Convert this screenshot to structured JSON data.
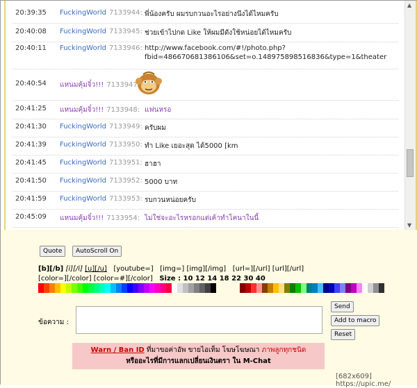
{
  "chat": {
    "rows": [
      {
        "time": "20:39:35",
        "user": "FuckingWorld",
        "msg_id": "7133944:",
        "message": "พี่น้องครับ ผมรบกวนอะไรอย่างนึงได้ไหมครับ",
        "user_color": "blue"
      },
      {
        "time": "20:40:08",
        "user": "FuckingWorld",
        "msg_id": "7133945:",
        "message": "ช่วยเข้าไปกด Like ให้ผมมีดังใช้หน่อยได้ไหมครับ",
        "user_color": "blue"
      },
      {
        "time": "20:40:11",
        "user": "FuckingWorld",
        "msg_id": "7133946:",
        "message": "http://www.facebook.com/#!/photo.php?",
        "message2": "fbid=486670681386106&set=o.148975898516836&type=1&theater",
        "user_color": "blue"
      },
      {
        "time": "20:40:54",
        "user": "แหนมคุ้มจิ๋ว!!!",
        "msg_id": "7133947:",
        "message": "",
        "user_color": "purple",
        "emoticon": "monkey-emoticon"
      },
      {
        "time": "20:41:25",
        "user": "แหนมคุ้มจิ๋ว!!!",
        "msg_id": "7133948:",
        "message": "แฟนหรอ",
        "user_color": "purple"
      },
      {
        "time": "20:41:30",
        "user": "FuckingWorld",
        "msg_id": "7133949:",
        "message": "ครับผม",
        "user_color": "blue"
      },
      {
        "time": "20:41:39",
        "user": "FuckingWorld",
        "msg_id": "7133950:",
        "message": "ทำ Like เยอะสุด ได้5000 [km",
        "user_color": "blue"
      },
      {
        "time": "20:41:45",
        "user": "FuckingWorld",
        "msg_id": "7133951:",
        "message": "ฮาฮา",
        "user_color": "blue"
      },
      {
        "time": "20:41:50",
        "user": "FuckingWorld",
        "msg_id": "7133952:",
        "message": "5000 บาท",
        "user_color": "blue"
      },
      {
        "time": "20:41:59",
        "user": "FuckingWorld",
        "msg_id": "7133953:",
        "message": "รบกวนหน่อยครับ",
        "user_color": "blue"
      },
      {
        "time": "20:45:09",
        "user": "แหนมคุ้มจิ๋ว!!!",
        "msg_id": "7133954:",
        "message": "ไม่ใช่จะอะไรหรอกแต่เค้าทำโคนาในนี้",
        "user_color": "purple"
      }
    ]
  },
  "toolbar": {
    "quote_label": "Quote",
    "autoscroll_label": "AutoScroll On"
  },
  "bbcode": {
    "line1": {
      "bold": "[b][/b]",
      "italic": "[i][/i]",
      "underline": "[u][/u]",
      "youtube": "[youtube=]",
      "img1": "[img=]",
      "img2": "[img][/img]",
      "url1": "[url=][/url]",
      "url2": "[url][/url]"
    },
    "line2": {
      "color1": "[color=][/color]",
      "color2": "[color=#][/color]",
      "size_label": "Size : 10 12 14 18 22 30 40"
    }
  },
  "palette": {
    "left": [
      "#ff0000",
      "#ff4000",
      "#ff8000",
      "#ffbf00",
      "#ffff00",
      "#bfff00",
      "#80ff00",
      "#40ff00",
      "#00ff00",
      "#00ff40",
      "#00ff80",
      "#00ffbf",
      "#00ffff",
      "#00bfff",
      "#0080ff",
      "#0040ff",
      "#0000ff",
      "#4000ff",
      "#8000ff",
      "#bf00ff",
      "#ff00ff",
      "#ff00bf",
      "#ff0080",
      "#ff0040",
      "#ffffff",
      "#e0e0e0",
      "#c0c0c0",
      "#a0a0a0",
      "#808080",
      "#606060",
      "#404040",
      "#000000"
    ],
    "right": [
      "#800000",
      "#c00000",
      "#ff3030",
      "#ff9090",
      "#804000",
      "#c08000",
      "#ffc000",
      "#ffe080",
      "#808000",
      "#008000",
      "#00c000",
      "#80ff80",
      "#008080",
      "#0080c0",
      "#40c0ff",
      "#000080",
      "#0000c0",
      "#4040ff",
      "#8080ff",
      "#800080",
      "#c000c0",
      "#ff80ff",
      "#ffffff",
      "#d0d0d0",
      "#909090",
      "#303030"
    ]
  },
  "form": {
    "message_label": "ข้อความ :",
    "send_label": "Send",
    "add_macro_label": "Add to macro",
    "reset_label": "Reset"
  },
  "warning": {
    "warn_link": "Warn / Ban ID",
    "text1": " ที่มาขอค่าอัพ ขายไอเท็ม โฆษโฆษณา ",
    "red_text": "ภาพลูกทุกชนิด",
    "line2": "หรืออะไรที่มีการแลกเปลี่ยนเงินตรา ใน M-Chat"
  },
  "watermark": "[682x609] https://upic.me/"
}
